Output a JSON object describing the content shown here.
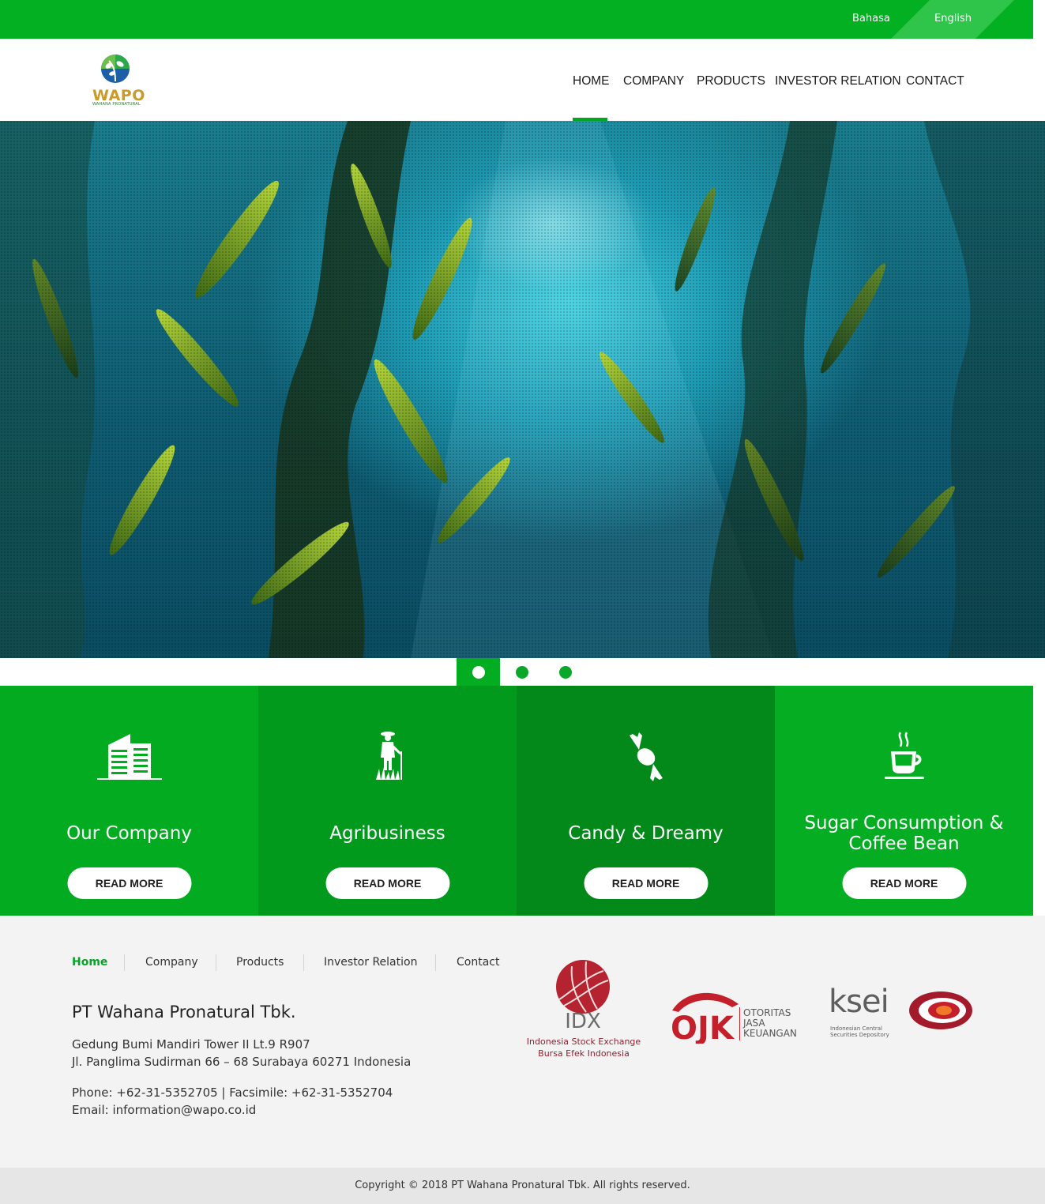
{
  "topbar": {
    "lang_bahasa": "Bahasa",
    "lang_english": "English"
  },
  "brand": {
    "logo_text": "WAPO",
    "logo_sub": "WAHANA PRONATURAL"
  },
  "nav": {
    "items": [
      "HOME",
      "COMPANY",
      "PRODUCTS",
      "INVESTOR RELATION",
      "CONTACT"
    ],
    "active": "HOME"
  },
  "slider": {
    "slide_count": 3,
    "active_index": 0
  },
  "tiles": [
    {
      "title": "Our Company",
      "button": "READ MORE",
      "icon": "building-icon",
      "color": "#03ab20"
    },
    {
      "title": "Agribusiness",
      "button": "READ MORE",
      "icon": "farmer-icon",
      "color": "#029a1d"
    },
    {
      "title": "Candy & Dreamy",
      "button": "READ MORE",
      "icon": "candy-icon",
      "color": "#02891a"
    },
    {
      "title_line1": "Sugar Consumption &",
      "title_line2": "Coffee Bean",
      "button": "READ MORE",
      "icon": "coffee-cup-icon",
      "color": "#04ad22"
    }
  ],
  "footer": {
    "nav": [
      "Home",
      "Company",
      "Products",
      "Investor Relation",
      "Contact"
    ],
    "company_name": "PT Wahana Pronatural Tbk.",
    "address_line1": "Gedung Bumi Mandiri Tower II Lt.9 R907",
    "address_line2": "Jl. Panglima Sudirman 66 – 68 Surabaya 60271 Indonesia",
    "phone_line": "Phone: +62-31-5352705 | Facsimile: +62-31-5352704",
    "email_line": "Email: information@wapo.co.id",
    "partners": {
      "idx": {
        "name": "IDX",
        "line1": "Indonesia Stock Exchange",
        "line2": "Bursa  Efek  Indonesia"
      },
      "ojk": {
        "name": "OJK",
        "line1": "OTORITAS",
        "line2": "JASA",
        "line3": "KEUANGAN"
      },
      "ksei": {
        "name": "ksei",
        "line1": "Indonesian Central",
        "line2": "Securities Depository"
      }
    }
  },
  "copyright": "Copyright © 2018 PT Wahana Pronatural Tbk. All rights reserved.",
  "colors": {
    "primary_green": "#03b021",
    "footer_bg": "#f3f3f3",
    "copyright_bg": "#e6e6e6"
  }
}
